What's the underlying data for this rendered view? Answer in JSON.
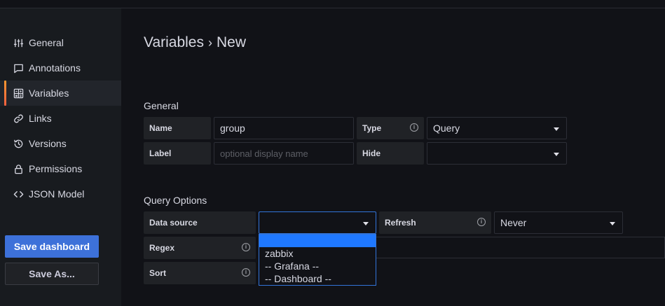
{
  "sidebar": {
    "items": [
      {
        "label": "General",
        "icon": "sliders-icon"
      },
      {
        "label": "Annotations",
        "icon": "comment-icon"
      },
      {
        "label": "Variables",
        "icon": "calculator-icon",
        "active": true
      },
      {
        "label": "Links",
        "icon": "link-icon"
      },
      {
        "label": "Versions",
        "icon": "history-icon"
      },
      {
        "label": "Permissions",
        "icon": "lock-icon"
      },
      {
        "label": "JSON Model",
        "icon": "code-icon"
      }
    ],
    "save_dashboard": "Save dashboard",
    "save_as": "Save As..."
  },
  "header": {
    "crumb_parent": "Variables",
    "separator": "›",
    "crumb_current": "New"
  },
  "general": {
    "title": "General",
    "name_label": "Name",
    "name_value": "group",
    "type_label": "Type",
    "type_value": "Query",
    "label_label": "Label",
    "label_placeholder": "optional display name",
    "hide_label": "Hide",
    "hide_value": ""
  },
  "query_options": {
    "title": "Query Options",
    "datasource_label": "Data source",
    "datasource_value": "",
    "refresh_label": "Refresh",
    "refresh_value": "Never",
    "regex_label": "Regex",
    "sort_label": "Sort",
    "datasource_options": [
      "",
      "zabbix",
      "-- Grafana --",
      "-- Dashboard --"
    ]
  },
  "colors": {
    "accent_blue": "#3d71d9",
    "active_indicator": "#ff9830",
    "highlight": "#1f78ff"
  }
}
